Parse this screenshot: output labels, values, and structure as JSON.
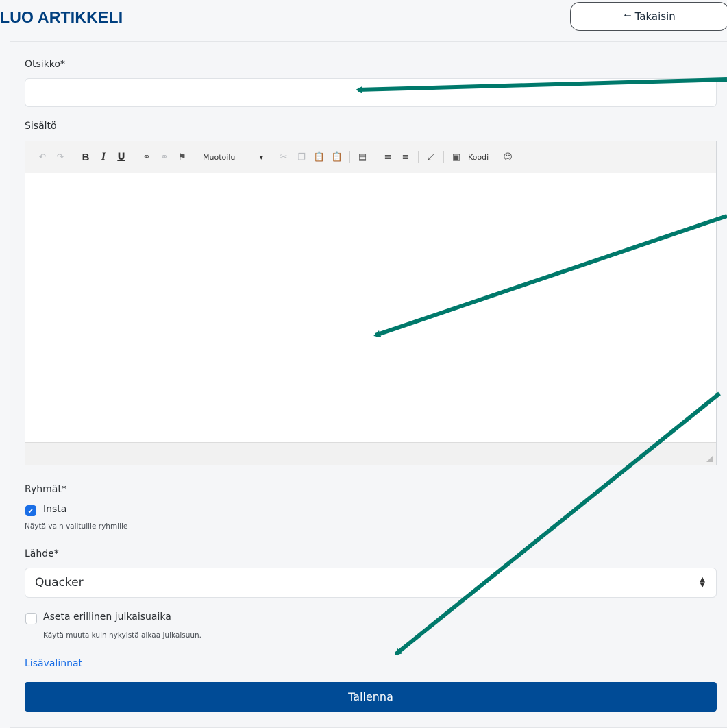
{
  "header": {
    "title": "LUO ARTIKKELI",
    "back_button": {
      "icon": "arrow-left-icon",
      "label": "Takaisin"
    }
  },
  "form": {
    "title_field": {
      "label": "Otsikko*",
      "value": "",
      "placeholder": ""
    },
    "content_field": {
      "label": "Sisältö",
      "toolbar": {
        "format_dropdown": "Muotoilu",
        "code_button": "Koodi"
      }
    },
    "groups": {
      "label": "Ryhmät*",
      "options": [
        {
          "label": "Insta",
          "checked": true
        }
      ],
      "help": "Näytä vain valituille ryhmille"
    },
    "source": {
      "label": "Lähde*",
      "selected": "Quacker"
    },
    "schedule": {
      "label": "Aseta erillinen julkaisuaika",
      "checked": false,
      "help": "Käytä muuta kuin nykyistä aikaa julkaisuun."
    },
    "more_options_link": "Lisävalinnat",
    "save_button": "Tallenna"
  },
  "colors": {
    "brand": "#003f7f",
    "primary_button": "#004b96",
    "link": "#1a6ee6",
    "annotation_arrow": "#00796b"
  }
}
